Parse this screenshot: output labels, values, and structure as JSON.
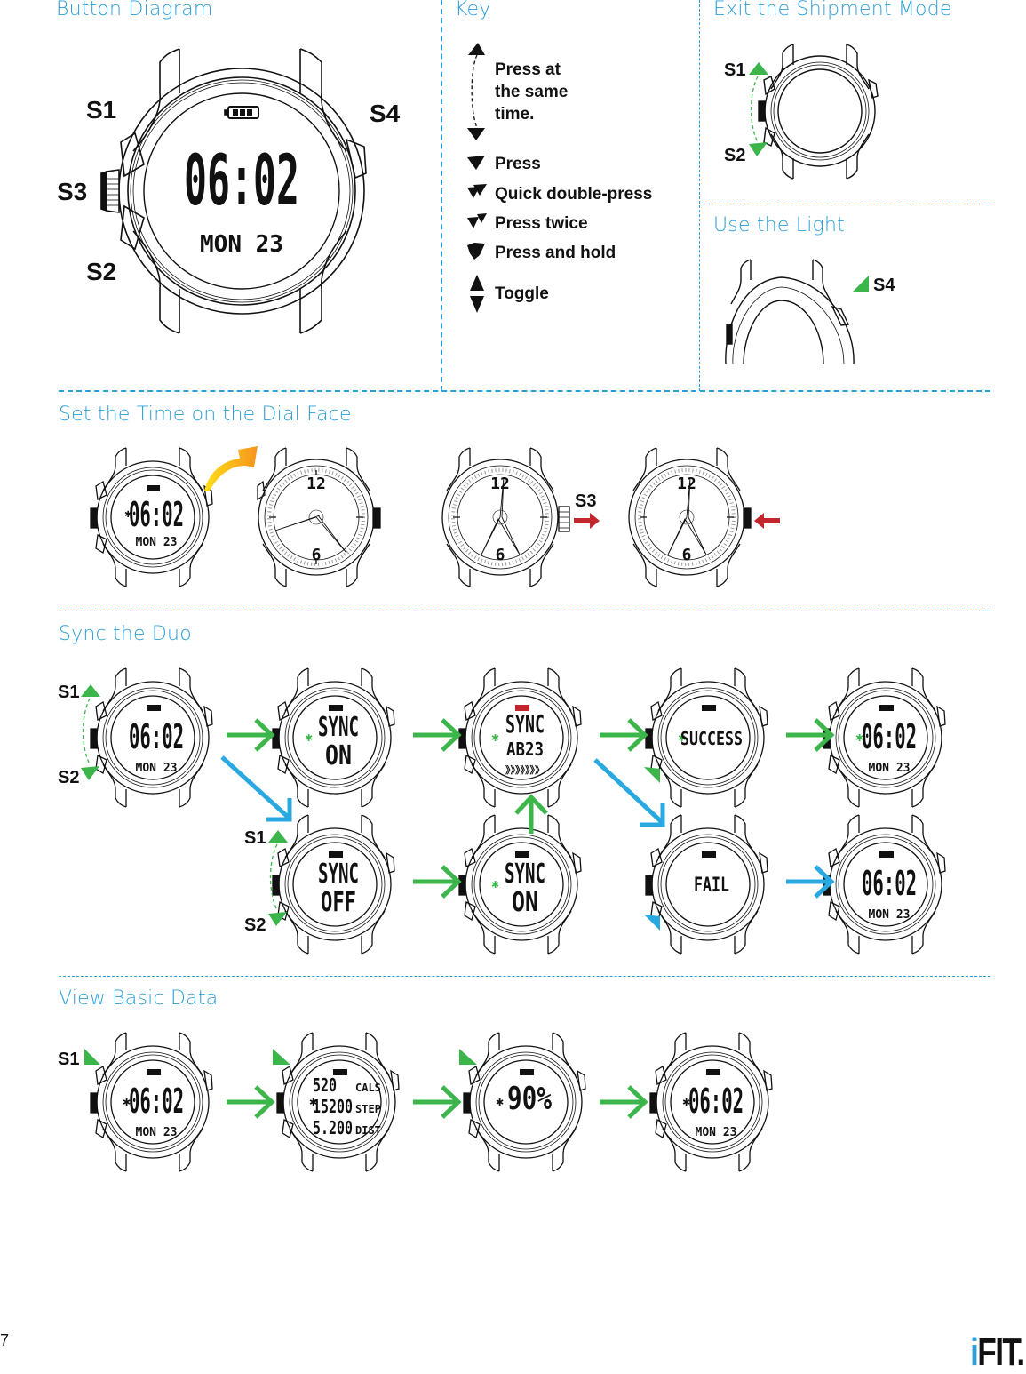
{
  "sections": {
    "button_diagram": {
      "title": "Button Diagram"
    },
    "key": {
      "title": "Key"
    },
    "exit_shipment": {
      "title": "Exit the Shipment Mode"
    },
    "use_light": {
      "title": "Use the Light"
    },
    "set_time": {
      "title": "Set the Time on the Dial Face"
    },
    "sync": {
      "title": "Sync the Duo"
    },
    "basic_data": {
      "title": "View Basic Data"
    }
  },
  "buttons": {
    "s1": "S1",
    "s2": "S2",
    "s3": "S3",
    "s4": "S4"
  },
  "key_items": [
    {
      "icon": "press-same-time-icon",
      "label": "Press at the same time."
    },
    {
      "icon": "press-icon",
      "label": "Press"
    },
    {
      "icon": "quick-double-press-icon",
      "label": "Quick double-press"
    },
    {
      "icon": "press-twice-icon",
      "label": "Press twice"
    },
    {
      "icon": "press-and-hold-icon",
      "label": "Press and hold"
    },
    {
      "icon": "toggle-icon",
      "label": "Toggle"
    }
  ],
  "key_lines": [
    "Press at",
    "the same",
    "time."
  ],
  "display": {
    "time": "06:02",
    "date": "MON  23",
    "sync": "SYNC",
    "on": "ON",
    "off": "OFF",
    "pair_code": "AB23",
    "progress": "》》》》》》》",
    "success": "SUCCESS",
    "fail": "FAIL",
    "cals_value": "520",
    "cals_label": "CALS",
    "step_value": "15200",
    "step_label": "STEP",
    "dist_value": "5.200",
    "dist_label": "DIST",
    "battery_percent": "90%",
    "dial_12": "12",
    "dial_6": "6"
  },
  "colors": {
    "accent": "#2a9fd8",
    "green": "#3cb54a",
    "blue": "#2aa9e0",
    "red": "#c1272d",
    "orange": "#f7941d",
    "yellow": "#ffde17"
  },
  "footer": {
    "page_number": "7",
    "logo": "iFIT"
  }
}
